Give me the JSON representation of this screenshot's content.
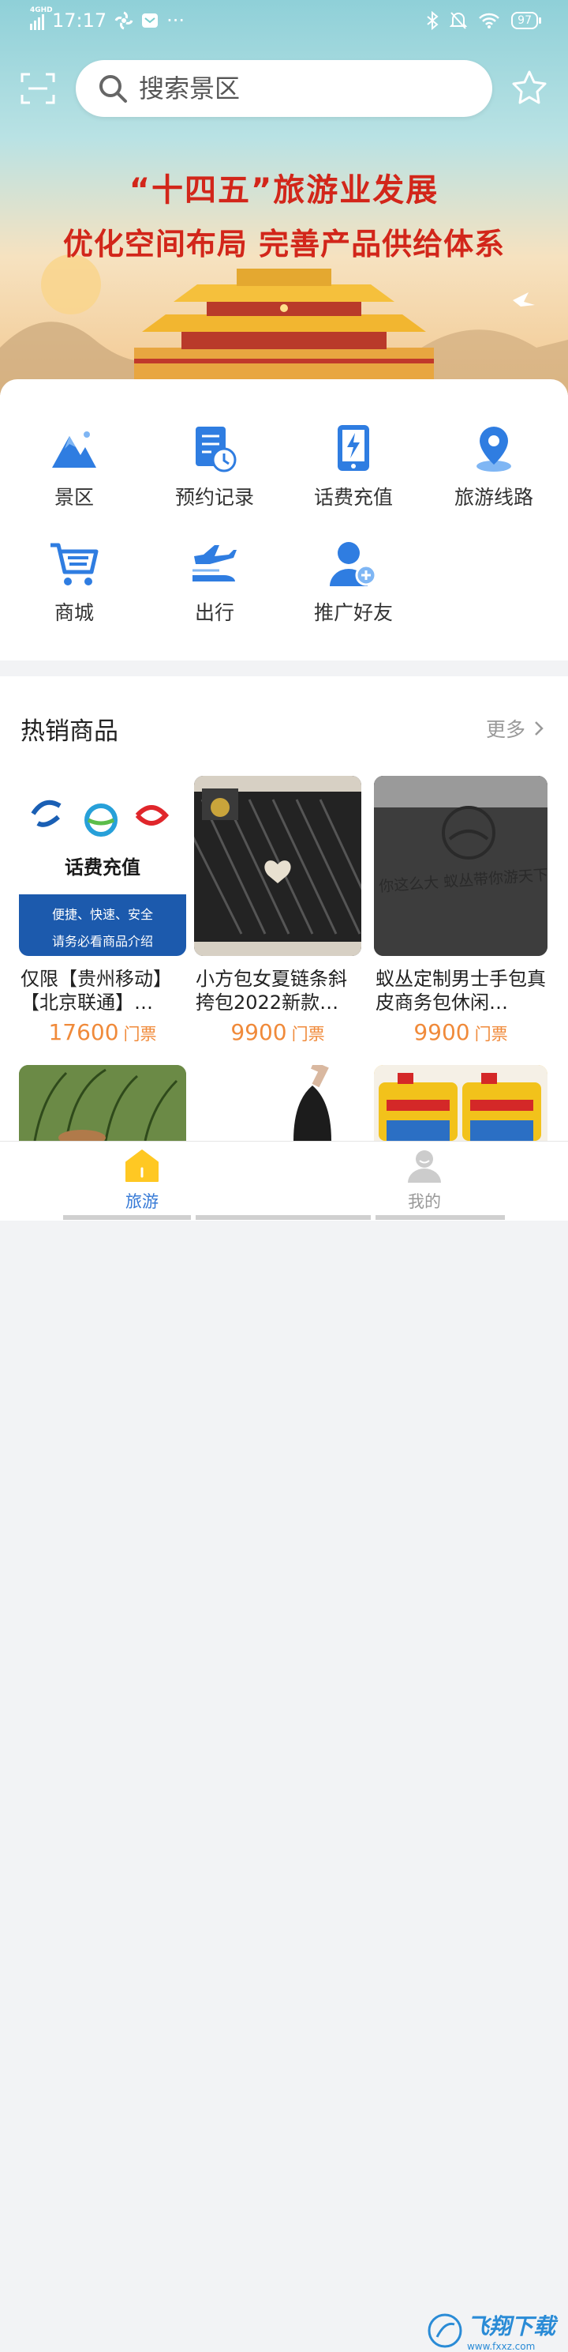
{
  "status_bar": {
    "net": "4GHD",
    "time": "17:17",
    "dots": "···",
    "battery": "97"
  },
  "search": {
    "placeholder": "搜索景区"
  },
  "banner": {
    "line1": "“十四五”旅游业发展",
    "line2": "优化空间布局 完善产品供给体系"
  },
  "menu": [
    {
      "label": "景区",
      "icon": "mountain-icon"
    },
    {
      "label": "预约记录",
      "icon": "document-clock-icon"
    },
    {
      "label": "话费充值",
      "icon": "phone-bolt-icon"
    },
    {
      "label": "旅游线路",
      "icon": "location-pin-icon"
    },
    {
      "label": "商城",
      "icon": "cart-icon"
    },
    {
      "label": "出行",
      "icon": "plane-train-icon"
    },
    {
      "label": "推广好友",
      "icon": "user-add-icon"
    }
  ],
  "hot": {
    "title": "热销商品",
    "more": "更多",
    "products": [
      {
        "name": "仅限【贵州移动】【北京联通】…",
        "price": "17600",
        "unit": "门票",
        "card": {
          "title": "话费充值",
          "line1": "便捷、快速、安全",
          "line2": "请务必看商品介绍"
        }
      },
      {
        "name": "小方包女夏链条斜挎包2022新款…",
        "price": "9900",
        "unit": "门票"
      },
      {
        "name": "蚁丛定制男士手包真皮商务包休闲…",
        "price": "9900",
        "unit": "门票",
        "engraving": "你这么大 蚁丛带你游天下"
      }
    ]
  },
  "tabs": [
    {
      "label": "旅游",
      "active": true
    },
    {
      "label": "我的",
      "active": false
    }
  ],
  "watermark": {
    "text": "飞翔下载",
    "sub": "www.fxxz.com"
  },
  "colors": {
    "brand_blue": "#2f7de1",
    "price_orange": "#f08a3a",
    "banner_red": "#d2261a",
    "tab_active": "#3579d6",
    "home_yellow": "#ffc823"
  }
}
